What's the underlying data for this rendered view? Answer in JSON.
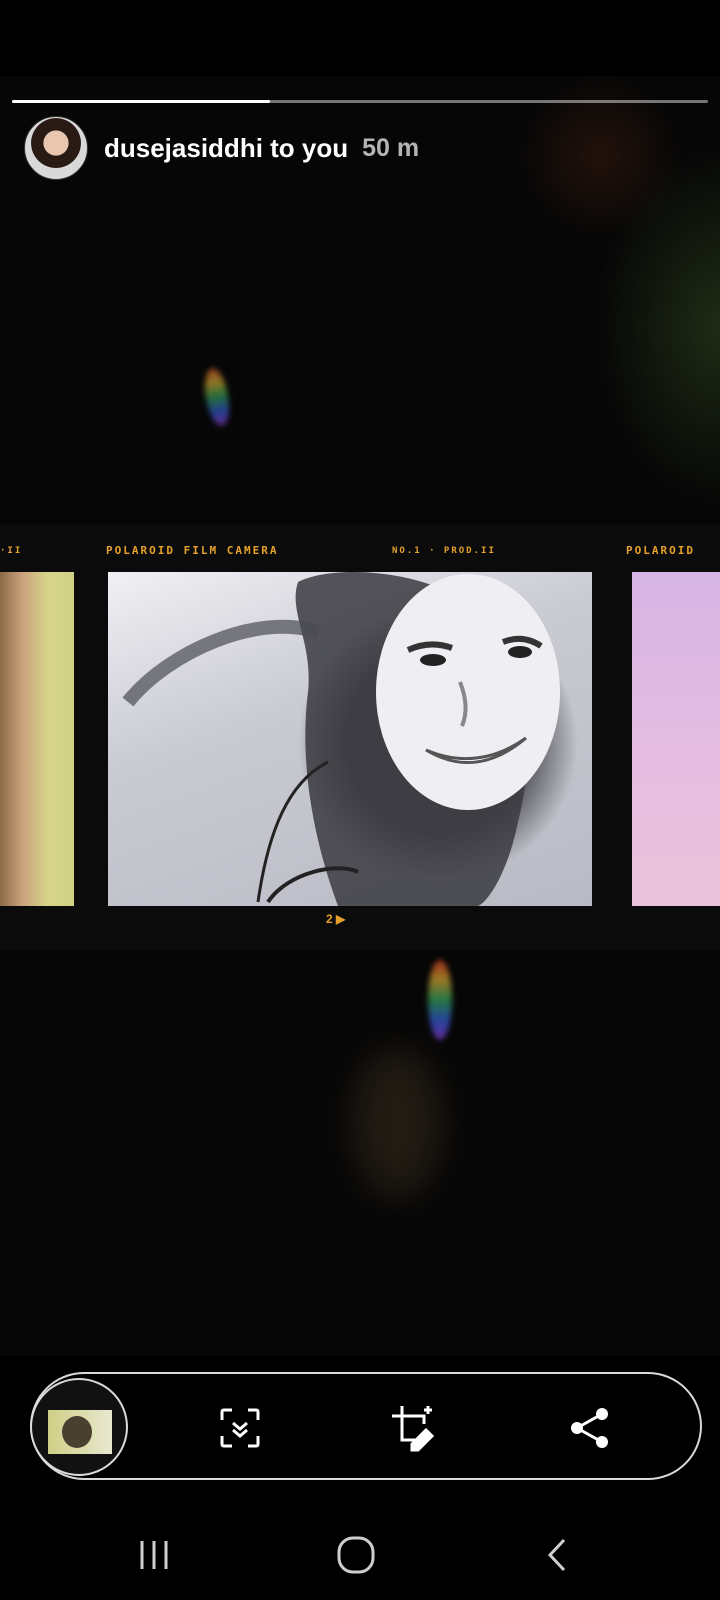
{
  "story": {
    "username": "dusejasiddhi to you",
    "time": "50 m",
    "progress": 0.37
  },
  "film": {
    "label_left": "POLAROID  FILM CAMERA",
    "label_mid": "NO.1  ·  PROD.II",
    "label_right": "POLAROID",
    "label_far_left": "·II",
    "frame_number": "2 ▶"
  },
  "actions": {
    "thumbnail": "story-thumbnail",
    "icons": [
      "scan-capture-icon",
      "crop-edit-icon",
      "share-icon"
    ]
  },
  "navigation": {
    "icons": [
      "recent-apps-icon",
      "home-icon",
      "back-icon"
    ]
  }
}
